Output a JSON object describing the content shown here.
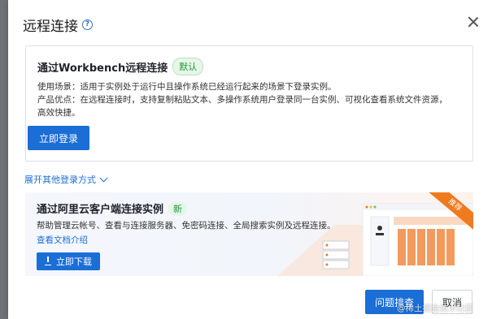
{
  "dialog": {
    "title": "远程连接",
    "close_label": "关闭"
  },
  "workbench": {
    "title": "通过Workbench远程连接",
    "badge": "默认",
    "usage": "使用场景：适用于实例处于运行中且操作系统已经运行起来的场景下登录实例。",
    "advantage_1": "产品优点：在远程连接时，支持复制粘贴文本、多操作系统用户登录同一台实例、可视化查看系统文件资源，",
    "advantage_2": "高效快捷。",
    "login_button": "立即登录"
  },
  "expand": {
    "label": "展开其他登录方式"
  },
  "client": {
    "title": "通过阿里云客户端连接实例",
    "badge": "新",
    "description": "帮助管理云帐号、查看与连接服务器、免密码连接、全局搜索实例及远程连接。",
    "docs_link": "查看文档介绍",
    "download_button": "立即下载",
    "ribbon": "推荐"
  },
  "footer": {
    "diagnose_button": "问题排查",
    "cancel_button": "取消"
  },
  "watermark": "@稀土掘金技术社区",
  "colors": {
    "primary": "#1a6ed6",
    "success": "#1d9a3a",
    "ribbon": "#f07a1e"
  }
}
